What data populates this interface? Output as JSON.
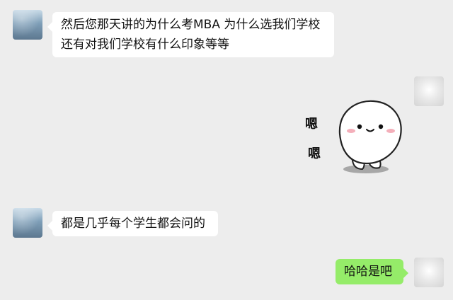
{
  "messages": [
    {
      "side": "left",
      "lines": [
        "然后您那天讲的为什么考MBA 为什么选我们学校",
        "还有对我们学校有什么印象等等"
      ]
    },
    {
      "side": "right",
      "type": "sticker",
      "sticker_text": [
        "嗯",
        "嗯"
      ]
    },
    {
      "side": "left",
      "lines": [
        "都是几乎每个学生都会问的"
      ]
    },
    {
      "side": "right",
      "lines": [
        "哈哈是吧"
      ]
    }
  ],
  "colors": {
    "background": "#ededed",
    "incoming_bubble": "#ffffff",
    "outgoing_bubble": "#95ec69"
  },
  "icons": {
    "sticker": "smiling-mochi-sticker"
  }
}
